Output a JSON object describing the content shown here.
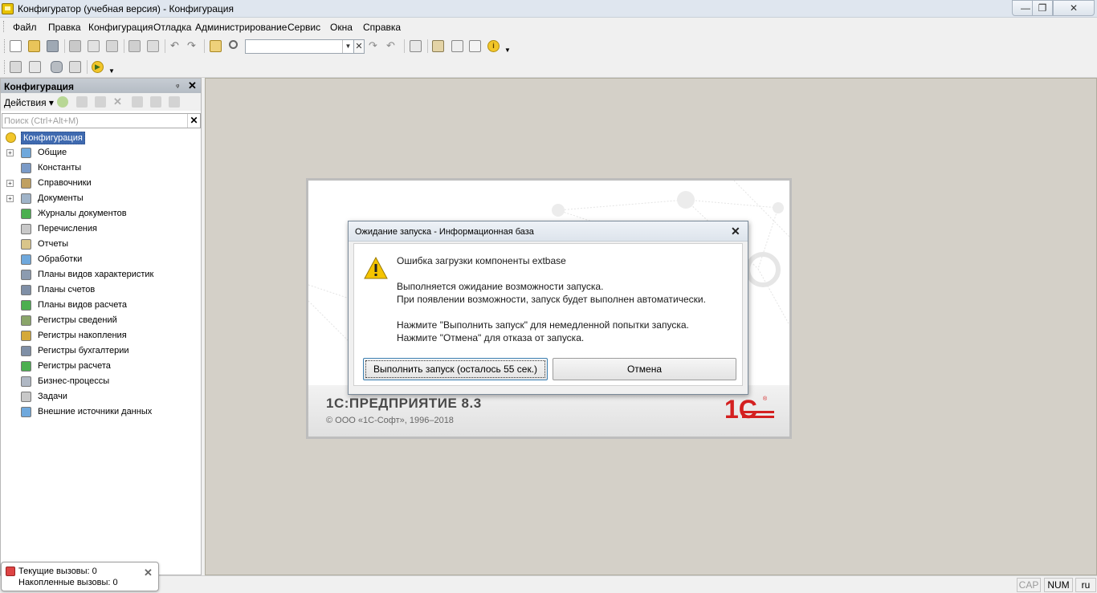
{
  "window": {
    "title": "Конфигуратор (учебная версия) - Конфигурация",
    "minimize": "—",
    "maximize": "❐",
    "close": "✕"
  },
  "menu": [
    "Файл",
    "Правка",
    "Конфигурация",
    "Отладка",
    "Администрирование",
    "Сервис",
    "Окна",
    "Справка"
  ],
  "panel": {
    "title": "Конфигурация",
    "actions_label": "Действия",
    "search_placeholder": "Поиск (Ctrl+Alt+M)",
    "tree_root": "Конфигурация",
    "tree_items": [
      {
        "label": "Общие",
        "icon": "common-icon",
        "expandable": true
      },
      {
        "label": "Константы",
        "icon": "constants-icon",
        "expandable": false
      },
      {
        "label": "Справочники",
        "icon": "catalogs-icon",
        "expandable": true
      },
      {
        "label": "Документы",
        "icon": "documents-icon",
        "expandable": true
      },
      {
        "label": "Журналы документов",
        "icon": "journals-icon",
        "expandable": false
      },
      {
        "label": "Перечисления",
        "icon": "enums-icon",
        "expandable": false
      },
      {
        "label": "Отчеты",
        "icon": "reports-icon",
        "expandable": false
      },
      {
        "label": "Обработки",
        "icon": "processing-icon",
        "expandable": false
      },
      {
        "label": "Планы видов характеристик",
        "icon": "char-types-icon",
        "expandable": false
      },
      {
        "label": "Планы счетов",
        "icon": "chart-of-accounts-icon",
        "expandable": false
      },
      {
        "label": "Планы видов расчета",
        "icon": "calc-types-icon",
        "expandable": false
      },
      {
        "label": "Регистры сведений",
        "icon": "info-registers-icon",
        "expandable": false
      },
      {
        "label": "Регистры накопления",
        "icon": "accum-registers-icon",
        "expandable": false
      },
      {
        "label": "Регистры бухгалтерии",
        "icon": "accounting-registers-icon",
        "expandable": false
      },
      {
        "label": "Регистры расчета",
        "icon": "calc-registers-icon",
        "expandable": false
      },
      {
        "label": "Бизнес-процессы",
        "icon": "business-processes-icon",
        "expandable": false
      },
      {
        "label": "Задачи",
        "icon": "tasks-icon",
        "expandable": false
      },
      {
        "label": "Внешние источники данных",
        "icon": "external-sources-icon",
        "expandable": false
      }
    ]
  },
  "splash": {
    "brand": "1С:ПРЕДПРИЯТИЕ 8.3",
    "copyright": "© ООО «1С-Софт», 1996–2018",
    "logo_text": "1С",
    "logo_reg": "®"
  },
  "dialog": {
    "title": "Ожидание запуска - Информационная база",
    "lines": [
      "Ошибка загрузки компоненты extbase",
      "Выполняется ожидание возможности запуска.",
      "При появлении возможности, запуск будет выполнен автоматически.",
      "Нажмите \"Выполнить запуск\" для немедленной попытки запуска.",
      "Нажмите \"Отмена\" для отказа от запуска."
    ],
    "run_button": "Выполнить запуск (осталось 55 сек.)",
    "cancel_button": "Отмена"
  },
  "calls": {
    "current": "Текущие вызовы: 0",
    "accumulated": "Накопленные вызовы: 0"
  },
  "status": {
    "cap": "CAP",
    "num": "NUM",
    "lang": "ru"
  },
  "colors": {
    "workspace": "#d4d0c8",
    "selection": "#3f6ab0",
    "logo_red": "#d42020",
    "warning_yellow": "#f5c400"
  }
}
